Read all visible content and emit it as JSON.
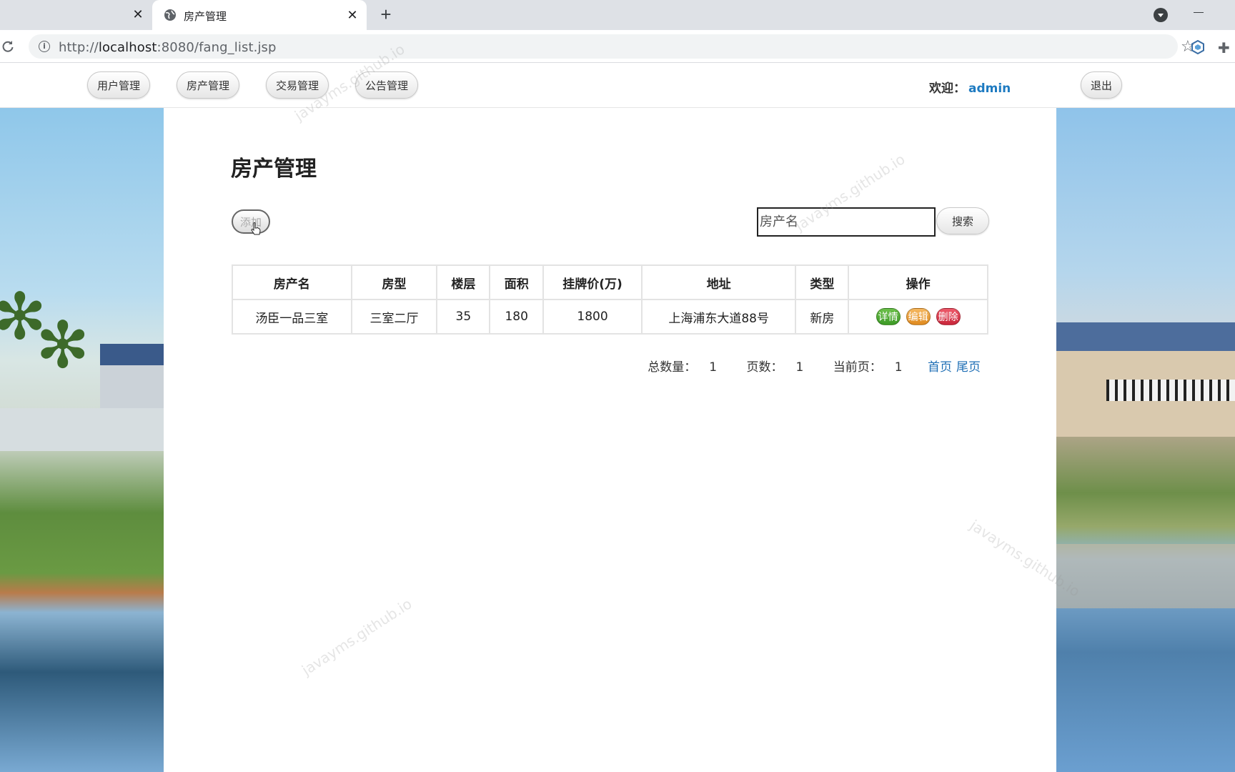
{
  "browser": {
    "tab_title": "房产管理",
    "url_prefix": "http://",
    "url_host": "localhost",
    "url_rest": ":8080/fang_list.jsp"
  },
  "nav": {
    "items": [
      {
        "label": "用户管理"
      },
      {
        "label": "房产管理"
      },
      {
        "label": "交易管理"
      },
      {
        "label": "公告管理"
      }
    ],
    "welcome_label": "欢迎：",
    "username": "admin",
    "logout_label": "退出"
  },
  "main": {
    "title": "房产管理",
    "add_label": "添加",
    "search_placeholder": "房产名",
    "search_label": "搜索"
  },
  "table": {
    "headers": [
      "房产名",
      "房型",
      "楼层",
      "面积",
      "挂牌价(万)",
      "地址",
      "类型",
      "操作"
    ],
    "rows": [
      {
        "name": "汤臣一品三室",
        "layout": "三室二厅",
        "floor": "35",
        "area": "180",
        "price": "1800",
        "address": "上海浦东大道88号",
        "type": "新房",
        "actions": {
          "detail": "详情",
          "edit": "编辑",
          "delete": "删除"
        }
      }
    ]
  },
  "pager": {
    "total_label": "总数量：",
    "total": "1",
    "pages_label": "页数：",
    "pages": "1",
    "current_label": "当前页：",
    "current": "1",
    "first": "首页",
    "last": "尾页"
  },
  "watermark": "javayms.github.io",
  "colors": {
    "accent": "#1f7bc1",
    "detail": "#4caf30",
    "edit": "#eca040",
    "delete": "#d9364a"
  }
}
